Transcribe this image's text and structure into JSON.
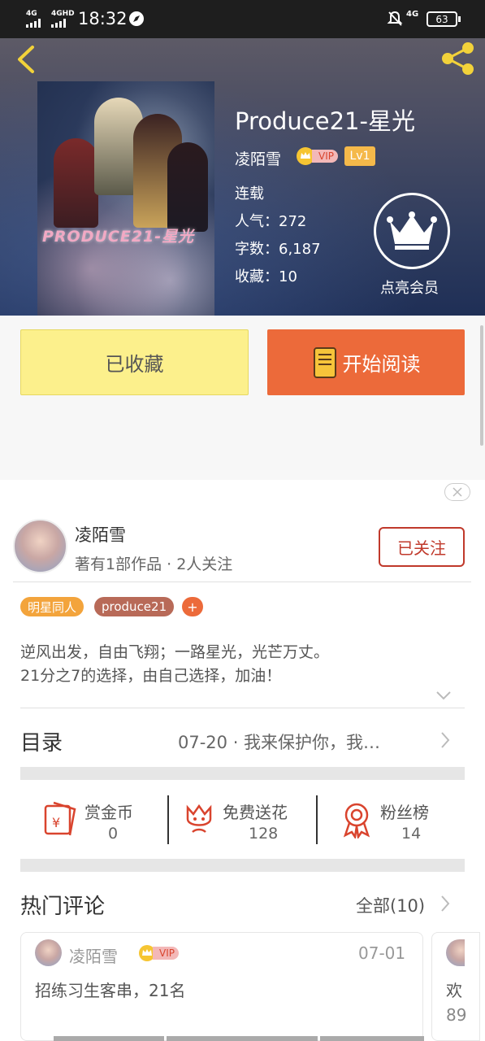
{
  "status": {
    "signal1": "4G",
    "signal2": "4GHD",
    "time": "18:32",
    "net": "4G",
    "battery": "63"
  },
  "book": {
    "title": "Produce21-星光",
    "author": "凌陌雪",
    "vip_badge": "VIP",
    "level_badge": "Lv1",
    "status": "连载",
    "popularity": "人气：272",
    "word_count": "字数：6,187",
    "favorites": "收藏：10",
    "cover_text": "PRODUCE21-星光",
    "member_label": "点亮会员"
  },
  "actions": {
    "collected_label": "已收藏",
    "read_label": "开始阅读"
  },
  "author_card": {
    "name": "凌陌雪",
    "info": "著有1部作品 · 2人关注",
    "follow_label": "已关注",
    "tags": [
      "明星同人",
      "produce21"
    ],
    "add_tag": "+",
    "description_line1": "逆风出发，自由飞翔；一路星光，光芒万丈。",
    "description_line2": "21分之7的选择，由自己选择，加油！"
  },
  "catalog": {
    "label": "目录",
    "latest": "07-20 · 我来保护你，我…"
  },
  "stats": [
    {
      "label": "赏金币",
      "value": "0"
    },
    {
      "label": "免费送花",
      "value": "128"
    },
    {
      "label": "粉丝榜",
      "value": "14"
    }
  ],
  "comments": {
    "title": "热门评论",
    "all_label": "全部(10)",
    "items": [
      {
        "user": "凌陌雪",
        "vip": "VIP",
        "date": "07-01",
        "text": "招练习生客串，21名"
      },
      {
        "user": "",
        "text_partial": "欢",
        "text_partial2": "89"
      }
    ]
  },
  "colors": {
    "accent_orange": "#ec6a3a",
    "yellow_btn": "#fcf08c",
    "tag_orange": "#f3a43c",
    "tag_brown": "#b86a58",
    "icon_red": "#d9442e",
    "follow_red": "#c0392b"
  }
}
